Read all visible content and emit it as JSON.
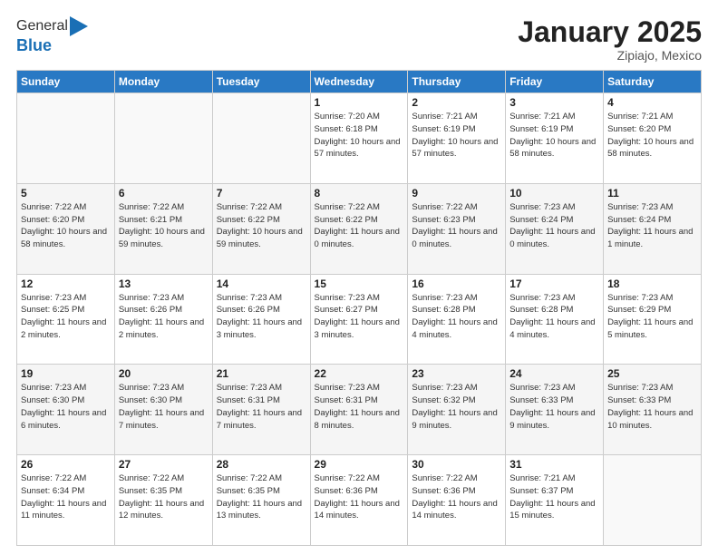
{
  "header": {
    "logo_general": "General",
    "logo_blue": "Blue",
    "main_title": "January 2025",
    "subtitle": "Zipiajo, Mexico"
  },
  "weekdays": [
    "Sunday",
    "Monday",
    "Tuesday",
    "Wednesday",
    "Thursday",
    "Friday",
    "Saturday"
  ],
  "weeks": [
    [
      {
        "day": "",
        "sunrise": "",
        "sunset": "",
        "daylight": ""
      },
      {
        "day": "",
        "sunrise": "",
        "sunset": "",
        "daylight": ""
      },
      {
        "day": "",
        "sunrise": "",
        "sunset": "",
        "daylight": ""
      },
      {
        "day": "1",
        "sunrise": "Sunrise: 7:20 AM",
        "sunset": "Sunset: 6:18 PM",
        "daylight": "Daylight: 10 hours and 57 minutes."
      },
      {
        "day": "2",
        "sunrise": "Sunrise: 7:21 AM",
        "sunset": "Sunset: 6:19 PM",
        "daylight": "Daylight: 10 hours and 57 minutes."
      },
      {
        "day": "3",
        "sunrise": "Sunrise: 7:21 AM",
        "sunset": "Sunset: 6:19 PM",
        "daylight": "Daylight: 10 hours and 58 minutes."
      },
      {
        "day": "4",
        "sunrise": "Sunrise: 7:21 AM",
        "sunset": "Sunset: 6:20 PM",
        "daylight": "Daylight: 10 hours and 58 minutes."
      }
    ],
    [
      {
        "day": "5",
        "sunrise": "Sunrise: 7:22 AM",
        "sunset": "Sunset: 6:20 PM",
        "daylight": "Daylight: 10 hours and 58 minutes."
      },
      {
        "day": "6",
        "sunrise": "Sunrise: 7:22 AM",
        "sunset": "Sunset: 6:21 PM",
        "daylight": "Daylight: 10 hours and 59 minutes."
      },
      {
        "day": "7",
        "sunrise": "Sunrise: 7:22 AM",
        "sunset": "Sunset: 6:22 PM",
        "daylight": "Daylight: 10 hours and 59 minutes."
      },
      {
        "day": "8",
        "sunrise": "Sunrise: 7:22 AM",
        "sunset": "Sunset: 6:22 PM",
        "daylight": "Daylight: 11 hours and 0 minutes."
      },
      {
        "day": "9",
        "sunrise": "Sunrise: 7:22 AM",
        "sunset": "Sunset: 6:23 PM",
        "daylight": "Daylight: 11 hours and 0 minutes."
      },
      {
        "day": "10",
        "sunrise": "Sunrise: 7:23 AM",
        "sunset": "Sunset: 6:24 PM",
        "daylight": "Daylight: 11 hours and 0 minutes."
      },
      {
        "day": "11",
        "sunrise": "Sunrise: 7:23 AM",
        "sunset": "Sunset: 6:24 PM",
        "daylight": "Daylight: 11 hours and 1 minute."
      }
    ],
    [
      {
        "day": "12",
        "sunrise": "Sunrise: 7:23 AM",
        "sunset": "Sunset: 6:25 PM",
        "daylight": "Daylight: 11 hours and 2 minutes."
      },
      {
        "day": "13",
        "sunrise": "Sunrise: 7:23 AM",
        "sunset": "Sunset: 6:26 PM",
        "daylight": "Daylight: 11 hours and 2 minutes."
      },
      {
        "day": "14",
        "sunrise": "Sunrise: 7:23 AM",
        "sunset": "Sunset: 6:26 PM",
        "daylight": "Daylight: 11 hours and 3 minutes."
      },
      {
        "day": "15",
        "sunrise": "Sunrise: 7:23 AM",
        "sunset": "Sunset: 6:27 PM",
        "daylight": "Daylight: 11 hours and 3 minutes."
      },
      {
        "day": "16",
        "sunrise": "Sunrise: 7:23 AM",
        "sunset": "Sunset: 6:28 PM",
        "daylight": "Daylight: 11 hours and 4 minutes."
      },
      {
        "day": "17",
        "sunrise": "Sunrise: 7:23 AM",
        "sunset": "Sunset: 6:28 PM",
        "daylight": "Daylight: 11 hours and 4 minutes."
      },
      {
        "day": "18",
        "sunrise": "Sunrise: 7:23 AM",
        "sunset": "Sunset: 6:29 PM",
        "daylight": "Daylight: 11 hours and 5 minutes."
      }
    ],
    [
      {
        "day": "19",
        "sunrise": "Sunrise: 7:23 AM",
        "sunset": "Sunset: 6:30 PM",
        "daylight": "Daylight: 11 hours and 6 minutes."
      },
      {
        "day": "20",
        "sunrise": "Sunrise: 7:23 AM",
        "sunset": "Sunset: 6:30 PM",
        "daylight": "Daylight: 11 hours and 7 minutes."
      },
      {
        "day": "21",
        "sunrise": "Sunrise: 7:23 AM",
        "sunset": "Sunset: 6:31 PM",
        "daylight": "Daylight: 11 hours and 7 minutes."
      },
      {
        "day": "22",
        "sunrise": "Sunrise: 7:23 AM",
        "sunset": "Sunset: 6:31 PM",
        "daylight": "Daylight: 11 hours and 8 minutes."
      },
      {
        "day": "23",
        "sunrise": "Sunrise: 7:23 AM",
        "sunset": "Sunset: 6:32 PM",
        "daylight": "Daylight: 11 hours and 9 minutes."
      },
      {
        "day": "24",
        "sunrise": "Sunrise: 7:23 AM",
        "sunset": "Sunset: 6:33 PM",
        "daylight": "Daylight: 11 hours and 9 minutes."
      },
      {
        "day": "25",
        "sunrise": "Sunrise: 7:23 AM",
        "sunset": "Sunset: 6:33 PM",
        "daylight": "Daylight: 11 hours and 10 minutes."
      }
    ],
    [
      {
        "day": "26",
        "sunrise": "Sunrise: 7:22 AM",
        "sunset": "Sunset: 6:34 PM",
        "daylight": "Daylight: 11 hours and 11 minutes."
      },
      {
        "day": "27",
        "sunrise": "Sunrise: 7:22 AM",
        "sunset": "Sunset: 6:35 PM",
        "daylight": "Daylight: 11 hours and 12 minutes."
      },
      {
        "day": "28",
        "sunrise": "Sunrise: 7:22 AM",
        "sunset": "Sunset: 6:35 PM",
        "daylight": "Daylight: 11 hours and 13 minutes."
      },
      {
        "day": "29",
        "sunrise": "Sunrise: 7:22 AM",
        "sunset": "Sunset: 6:36 PM",
        "daylight": "Daylight: 11 hours and 14 minutes."
      },
      {
        "day": "30",
        "sunrise": "Sunrise: 7:22 AM",
        "sunset": "Sunset: 6:36 PM",
        "daylight": "Daylight: 11 hours and 14 minutes."
      },
      {
        "day": "31",
        "sunrise": "Sunrise: 7:21 AM",
        "sunset": "Sunset: 6:37 PM",
        "daylight": "Daylight: 11 hours and 15 minutes."
      },
      {
        "day": "",
        "sunrise": "",
        "sunset": "",
        "daylight": ""
      }
    ]
  ]
}
